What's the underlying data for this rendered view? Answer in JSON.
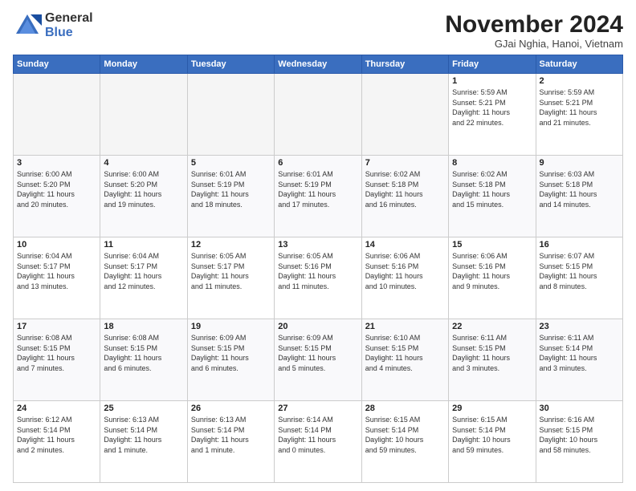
{
  "logo": {
    "general": "General",
    "blue": "Blue"
  },
  "title": "November 2024",
  "subtitle": "GJai Nghia, Hanoi, Vietnam",
  "days_header": [
    "Sunday",
    "Monday",
    "Tuesday",
    "Wednesday",
    "Thursday",
    "Friday",
    "Saturday"
  ],
  "weeks": [
    [
      {
        "day": "",
        "info": ""
      },
      {
        "day": "",
        "info": ""
      },
      {
        "day": "",
        "info": ""
      },
      {
        "day": "",
        "info": ""
      },
      {
        "day": "",
        "info": ""
      },
      {
        "day": "1",
        "info": "Sunrise: 5:59 AM\nSunset: 5:21 PM\nDaylight: 11 hours\nand 22 minutes."
      },
      {
        "day": "2",
        "info": "Sunrise: 5:59 AM\nSunset: 5:21 PM\nDaylight: 11 hours\nand 21 minutes."
      }
    ],
    [
      {
        "day": "3",
        "info": "Sunrise: 6:00 AM\nSunset: 5:20 PM\nDaylight: 11 hours\nand 20 minutes."
      },
      {
        "day": "4",
        "info": "Sunrise: 6:00 AM\nSunset: 5:20 PM\nDaylight: 11 hours\nand 19 minutes."
      },
      {
        "day": "5",
        "info": "Sunrise: 6:01 AM\nSunset: 5:19 PM\nDaylight: 11 hours\nand 18 minutes."
      },
      {
        "day": "6",
        "info": "Sunrise: 6:01 AM\nSunset: 5:19 PM\nDaylight: 11 hours\nand 17 minutes."
      },
      {
        "day": "7",
        "info": "Sunrise: 6:02 AM\nSunset: 5:18 PM\nDaylight: 11 hours\nand 16 minutes."
      },
      {
        "day": "8",
        "info": "Sunrise: 6:02 AM\nSunset: 5:18 PM\nDaylight: 11 hours\nand 15 minutes."
      },
      {
        "day": "9",
        "info": "Sunrise: 6:03 AM\nSunset: 5:18 PM\nDaylight: 11 hours\nand 14 minutes."
      }
    ],
    [
      {
        "day": "10",
        "info": "Sunrise: 6:04 AM\nSunset: 5:17 PM\nDaylight: 11 hours\nand 13 minutes."
      },
      {
        "day": "11",
        "info": "Sunrise: 6:04 AM\nSunset: 5:17 PM\nDaylight: 11 hours\nand 12 minutes."
      },
      {
        "day": "12",
        "info": "Sunrise: 6:05 AM\nSunset: 5:17 PM\nDaylight: 11 hours\nand 11 minutes."
      },
      {
        "day": "13",
        "info": "Sunrise: 6:05 AM\nSunset: 5:16 PM\nDaylight: 11 hours\nand 11 minutes."
      },
      {
        "day": "14",
        "info": "Sunrise: 6:06 AM\nSunset: 5:16 PM\nDaylight: 11 hours\nand 10 minutes."
      },
      {
        "day": "15",
        "info": "Sunrise: 6:06 AM\nSunset: 5:16 PM\nDaylight: 11 hours\nand 9 minutes."
      },
      {
        "day": "16",
        "info": "Sunrise: 6:07 AM\nSunset: 5:15 PM\nDaylight: 11 hours\nand 8 minutes."
      }
    ],
    [
      {
        "day": "17",
        "info": "Sunrise: 6:08 AM\nSunset: 5:15 PM\nDaylight: 11 hours\nand 7 minutes."
      },
      {
        "day": "18",
        "info": "Sunrise: 6:08 AM\nSunset: 5:15 PM\nDaylight: 11 hours\nand 6 minutes."
      },
      {
        "day": "19",
        "info": "Sunrise: 6:09 AM\nSunset: 5:15 PM\nDaylight: 11 hours\nand 6 minutes."
      },
      {
        "day": "20",
        "info": "Sunrise: 6:09 AM\nSunset: 5:15 PM\nDaylight: 11 hours\nand 5 minutes."
      },
      {
        "day": "21",
        "info": "Sunrise: 6:10 AM\nSunset: 5:15 PM\nDaylight: 11 hours\nand 4 minutes."
      },
      {
        "day": "22",
        "info": "Sunrise: 6:11 AM\nSunset: 5:15 PM\nDaylight: 11 hours\nand 3 minutes."
      },
      {
        "day": "23",
        "info": "Sunrise: 6:11 AM\nSunset: 5:14 PM\nDaylight: 11 hours\nand 3 minutes."
      }
    ],
    [
      {
        "day": "24",
        "info": "Sunrise: 6:12 AM\nSunset: 5:14 PM\nDaylight: 11 hours\nand 2 minutes."
      },
      {
        "day": "25",
        "info": "Sunrise: 6:13 AM\nSunset: 5:14 PM\nDaylight: 11 hours\nand 1 minute."
      },
      {
        "day": "26",
        "info": "Sunrise: 6:13 AM\nSunset: 5:14 PM\nDaylight: 11 hours\nand 1 minute."
      },
      {
        "day": "27",
        "info": "Sunrise: 6:14 AM\nSunset: 5:14 PM\nDaylight: 11 hours\nand 0 minutes."
      },
      {
        "day": "28",
        "info": "Sunrise: 6:15 AM\nSunset: 5:14 PM\nDaylight: 10 hours\nand 59 minutes."
      },
      {
        "day": "29",
        "info": "Sunrise: 6:15 AM\nSunset: 5:14 PM\nDaylight: 10 hours\nand 59 minutes."
      },
      {
        "day": "30",
        "info": "Sunrise: 6:16 AM\nSunset: 5:15 PM\nDaylight: 10 hours\nand 58 minutes."
      }
    ]
  ]
}
